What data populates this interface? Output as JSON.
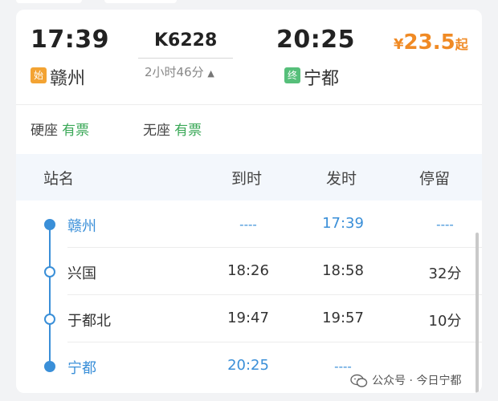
{
  "train": {
    "departure_time": "17:39",
    "departure_station": "赣州",
    "departure_badge": "始",
    "number": "K6228",
    "duration": "2小时46分",
    "duration_caret": "▲",
    "arrival_time": "20:25",
    "arrival_station": "宁都",
    "arrival_badge": "终",
    "price_symbol": "¥",
    "price": "23.5",
    "price_suffix": "起"
  },
  "seats": [
    {
      "type": "硬座",
      "status": "有票"
    },
    {
      "type": "无座",
      "status": "有票"
    }
  ],
  "table": {
    "headers": [
      "站名",
      "到时",
      "发时",
      "停留"
    ],
    "rows": [
      {
        "station": "赣州",
        "arrive": "----",
        "depart": "17:39",
        "stay": "----"
      },
      {
        "station": "兴国",
        "arrive": "18:26",
        "depart": "18:58",
        "stay": "32分"
      },
      {
        "station": "于都北",
        "arrive": "19:47",
        "depart": "19:57",
        "stay": "10分"
      },
      {
        "station": "宁都",
        "arrive": "20:25",
        "depart": "----",
        "stay": ""
      }
    ]
  },
  "watermark": "公众号 · 今日宁都",
  "colors": {
    "accent_blue": "#3a8fd8",
    "ticket_green": "#3aa857",
    "price_orange": "#f08a24",
    "origin_badge": "#f3a333",
    "terminal_badge": "#56bf7a"
  }
}
